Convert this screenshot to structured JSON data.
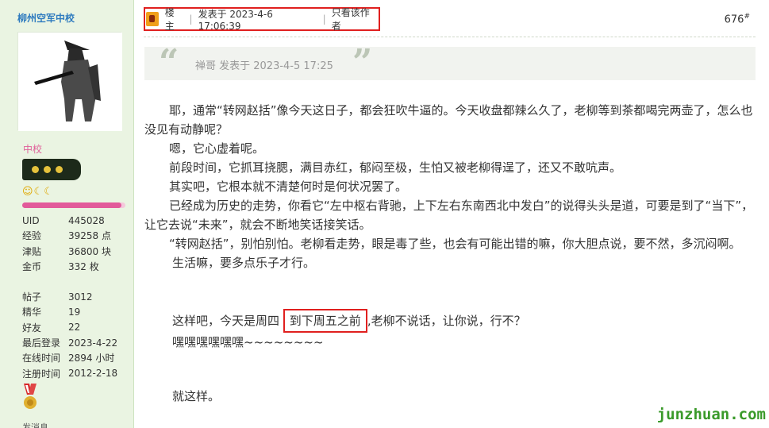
{
  "sidebar": {
    "username": "柳州空军中校",
    "rank": "中校",
    "stats": [
      {
        "key": "UID",
        "value": "445028"
      },
      {
        "key": "经验",
        "value": "39258 点"
      },
      {
        "key": "津贴",
        "value": "36800 块"
      },
      {
        "key": "金币",
        "value": "332 枚"
      }
    ],
    "stats2": [
      {
        "key": "帖子",
        "value": "3012"
      },
      {
        "key": "精华",
        "value": "19"
      },
      {
        "key": "好友",
        "value": "22"
      },
      {
        "key": "最后登录",
        "value": "2023-4-22"
      },
      {
        "key": "在线时间",
        "value": "2894 小时"
      },
      {
        "key": "注册时间",
        "value": "2012-2-18"
      }
    ],
    "more_label": "发消息",
    "progress": 0.96
  },
  "post": {
    "louzhu": "楼主",
    "posted_at": "发表于 2023-4-6 17:06:39",
    "only_author": "只看该作者",
    "floor": "676",
    "floor_sup": "#"
  },
  "quote": {
    "text": "禅哥 发表于 2023-4-5 17:25"
  },
  "content": {
    "p1": "耶，通常“转网赵括”像今天这日子，都会狂吹牛逼的。今天收盘都辣么久了，老柳等到茶都喝完两壶了，怎么也没见有动静呢？",
    "p2": "嗯，它心虚着呢。",
    "p3": "前段时间，它抓耳挠腮，满目赤红，郁闷至极，生怕又被老柳得逞了，还又不敢吭声。",
    "p4": "其实吧，它根本就不清楚何时是何状况罢了。",
    "p5": "已经成为历史的走势，你看它“左中枢右背驰，上下左右东南西北中发白”的说得头头是道，可要是到了“当下”，让它去说“未来”，就会不断地笑话接笑话。",
    "p6": "“转网赵括”，别怕别怕。老柳看走势，眼是毒了些，也会有可能出错的嘛，你大胆点说，要不然，多沉闷啊。",
    "p7": "生活嘛，要多点乐子才行。",
    "p8a": "这样吧，今天是周四",
    "p8b": "到下周五之前",
    "p8c": ",老柳不说话，让你说，行不？",
    "p9": "嘿嘿嘿嘿嘿嘿~~~~~~~~",
    "p10": "就这样。"
  },
  "watermark": "junzhuan.com"
}
